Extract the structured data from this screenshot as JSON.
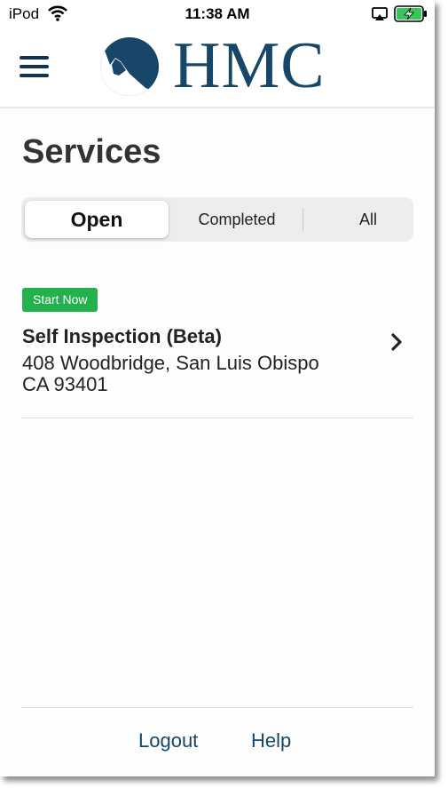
{
  "status_bar": {
    "carrier": "iPod",
    "time": "11:38 AM",
    "icons": [
      "wifi-icon",
      "airplay-icon",
      "battery-charging-icon"
    ]
  },
  "header": {
    "menu_icon": "hamburger-menu-icon",
    "logo_text": "HMC",
    "colors": {
      "brand": "#174669"
    }
  },
  "page": {
    "title": "Services"
  },
  "tabs": [
    {
      "label": "Open",
      "selected": true
    },
    {
      "label": "Completed",
      "selected": false
    },
    {
      "label": "All",
      "selected": false
    }
  ],
  "services": [
    {
      "badge": "Start Now",
      "title": "Self Inspection (Beta)",
      "address_line1": "408 Woodbridge, San Luis Obispo",
      "address_line2": "CA 93401",
      "badge_color": "#22b14c"
    }
  ],
  "footer": {
    "logout_label": "Logout",
    "help_label": "Help"
  }
}
